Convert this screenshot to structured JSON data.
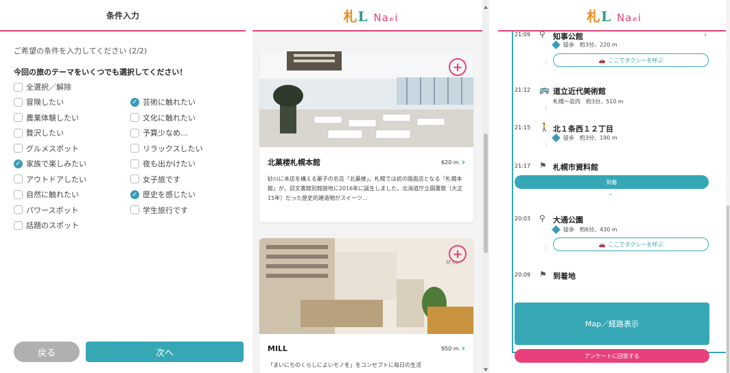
{
  "panel1": {
    "header": "条件入力",
    "instruction": "ご希望の条件を入力してください (2/2)",
    "question": "今回の旅のテーマをいくつでも選択してください！",
    "select_all": "全選択／解除",
    "options": [
      {
        "label": "冒険したい",
        "checked": false
      },
      {
        "label": "芸術に触れたい",
        "checked": true
      },
      {
        "label": "農業体験したい",
        "checked": false
      },
      {
        "label": "文化に触れたい",
        "checked": false
      },
      {
        "label": "贅沢したい",
        "checked": false
      },
      {
        "label": "予算少なめ...",
        "checked": false
      },
      {
        "label": "グルメスポット",
        "checked": false
      },
      {
        "label": "リラックスしたい",
        "checked": false
      },
      {
        "label": "家族で楽しみたい",
        "checked": true
      },
      {
        "label": "夜も出かけたい",
        "checked": false
      },
      {
        "label": "アウトドアしたい",
        "checked": false
      },
      {
        "label": "女子旅です",
        "checked": false
      },
      {
        "label": "自然に触れたい",
        "checked": false
      },
      {
        "label": "歴史を感じたい",
        "checked": true
      },
      {
        "label": "パワースポット",
        "checked": false
      },
      {
        "label": "学生旅行です",
        "checked": false
      },
      {
        "label": "話題のスポット",
        "checked": false
      }
    ],
    "back_label": "戻る",
    "next_label": "次へ"
  },
  "logo": {
    "part1": "札",
    "part2": "L",
    "part3": "Na𝓋i"
  },
  "panel2": {
    "cards": [
      {
        "title": "北菓楼札幌本館",
        "distance": "620 m",
        "description": "砂川に本店を構える菓子の名店「北菓楼」。札幌では初の路面店となる「札幌本館」が、旧文書館別館跡地に2016年に誕生しました。北海道庁立図書館（大正15年）だった歴史的建造物がスイーツ..."
      },
      {
        "title": "MILL",
        "distance": "950 m",
        "description": "「まいにちのくらしによいモノを」をコンセプトに毎日の生活"
      }
    ]
  },
  "panel3": {
    "stops": [
      {
        "time": "21:09",
        "name": "知事公館",
        "walk": "徒歩　約3分、220 m",
        "taxi": "ここでタクシーを呼ぶ"
      },
      {
        "time": "21:12",
        "name": "道立近代美術館",
        "sub": "札幌〜岩内　約3分、510 m"
      },
      {
        "time": "21:15",
        "name": "北１条西１２丁目",
        "walk": "徒歩　約3分、190 m"
      },
      {
        "time": "21:17",
        "name": "札幌市資料館",
        "arrive": "到着"
      },
      {
        "time": "20:03",
        "name": "大通公園",
        "walk": "徒歩　約6分、430 m",
        "taxi": "ここでタクシーを呼ぶ"
      },
      {
        "time": "20:09",
        "name": "到着地"
      }
    ],
    "map_button": "Map／経路表示",
    "survey_button": "アンケートに回答する"
  }
}
